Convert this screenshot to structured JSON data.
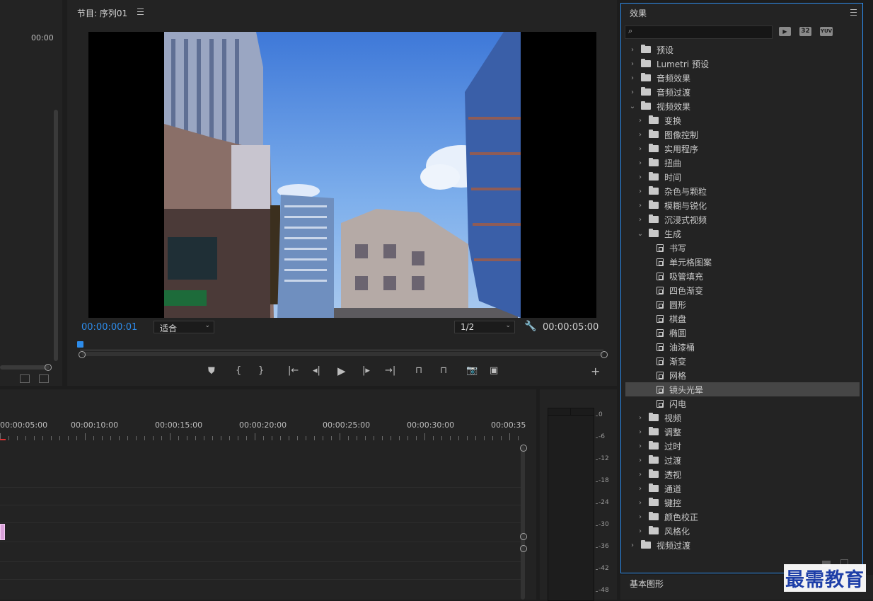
{
  "source_panel": {
    "timecode": "00:00"
  },
  "program": {
    "title": "节目: 序列01",
    "menu_icon": "hamburger-icon",
    "timecode_current": "00:00:00:01",
    "fit_label": "适合",
    "resolution_label": "1/2",
    "timecode_duration": "00:00:05:00"
  },
  "timeline": {
    "ruler_labels": [
      "00:00:05:00",
      "00:00:10:00",
      "00:00:15:00",
      "00:00:20:00",
      "00:00:25:00",
      "00:00:30:00",
      "00:00:35"
    ]
  },
  "meter": {
    "scale": [
      "0",
      "-6",
      "-12",
      "-18",
      "-24",
      "-30",
      "-36",
      "-42",
      "-48"
    ]
  },
  "effects": {
    "title": "效果",
    "badge_accel": "▶",
    "badge_32": "32",
    "badge_yuv": "YUV",
    "tree": [
      {
        "label": "预设",
        "level": 0,
        "kind": "preset",
        "open": false
      },
      {
        "label": "Lumetri 预设",
        "level": 0,
        "kind": "preset",
        "open": false
      },
      {
        "label": "音频效果",
        "level": 0,
        "kind": "folder",
        "open": false
      },
      {
        "label": "音频过渡",
        "level": 0,
        "kind": "folder",
        "open": false
      },
      {
        "label": "视频效果",
        "level": 0,
        "kind": "folder",
        "open": true
      },
      {
        "label": "变换",
        "level": 1,
        "kind": "folder",
        "open": false
      },
      {
        "label": "图像控制",
        "level": 1,
        "kind": "folder",
        "open": false
      },
      {
        "label": "实用程序",
        "level": 1,
        "kind": "folder",
        "open": false
      },
      {
        "label": "扭曲",
        "level": 1,
        "kind": "folder",
        "open": false
      },
      {
        "label": "时间",
        "level": 1,
        "kind": "folder",
        "open": false
      },
      {
        "label": "杂色与颗粒",
        "level": 1,
        "kind": "folder",
        "open": false
      },
      {
        "label": "模糊与锐化",
        "level": 1,
        "kind": "folder",
        "open": false
      },
      {
        "label": "沉浸式视频",
        "level": 1,
        "kind": "folder",
        "open": false
      },
      {
        "label": "生成",
        "level": 1,
        "kind": "folder",
        "open": true
      },
      {
        "label": "书写",
        "level": 2,
        "kind": "effect"
      },
      {
        "label": "单元格图案",
        "level": 2,
        "kind": "effect"
      },
      {
        "label": "吸管填充",
        "level": 2,
        "kind": "effect"
      },
      {
        "label": "四色渐变",
        "level": 2,
        "kind": "effect"
      },
      {
        "label": "圆形",
        "level": 2,
        "kind": "effect"
      },
      {
        "label": "棋盘",
        "level": 2,
        "kind": "effect"
      },
      {
        "label": "椭圆",
        "level": 2,
        "kind": "effect"
      },
      {
        "label": "油漆桶",
        "level": 2,
        "kind": "effect"
      },
      {
        "label": "渐变",
        "level": 2,
        "kind": "effect"
      },
      {
        "label": "网格",
        "level": 2,
        "kind": "effect"
      },
      {
        "label": "镜头光晕",
        "level": 2,
        "kind": "effect",
        "selected": true
      },
      {
        "label": "闪电",
        "level": 2,
        "kind": "effect"
      },
      {
        "label": "视频",
        "level": 1,
        "kind": "folder",
        "open": false
      },
      {
        "label": "调整",
        "level": 1,
        "kind": "folder",
        "open": false
      },
      {
        "label": "过时",
        "level": 1,
        "kind": "folder",
        "open": false
      },
      {
        "label": "过渡",
        "level": 1,
        "kind": "folder",
        "open": false
      },
      {
        "label": "透视",
        "level": 1,
        "kind": "folder",
        "open": false
      },
      {
        "label": "通道",
        "level": 1,
        "kind": "folder",
        "open": false
      },
      {
        "label": "键控",
        "level": 1,
        "kind": "folder",
        "open": false
      },
      {
        "label": "颜色校正",
        "level": 1,
        "kind": "folder",
        "open": false
      },
      {
        "label": "风格化",
        "level": 1,
        "kind": "folder",
        "open": false
      },
      {
        "label": "视频过渡",
        "level": 0,
        "kind": "folder",
        "open": false
      }
    ]
  },
  "essential_graphics": {
    "title": "基本图形"
  },
  "watermark": {
    "text": "最需教育"
  },
  "colors": {
    "accent": "#2d8ceb",
    "selection": "#464646",
    "panel": "#232323"
  }
}
